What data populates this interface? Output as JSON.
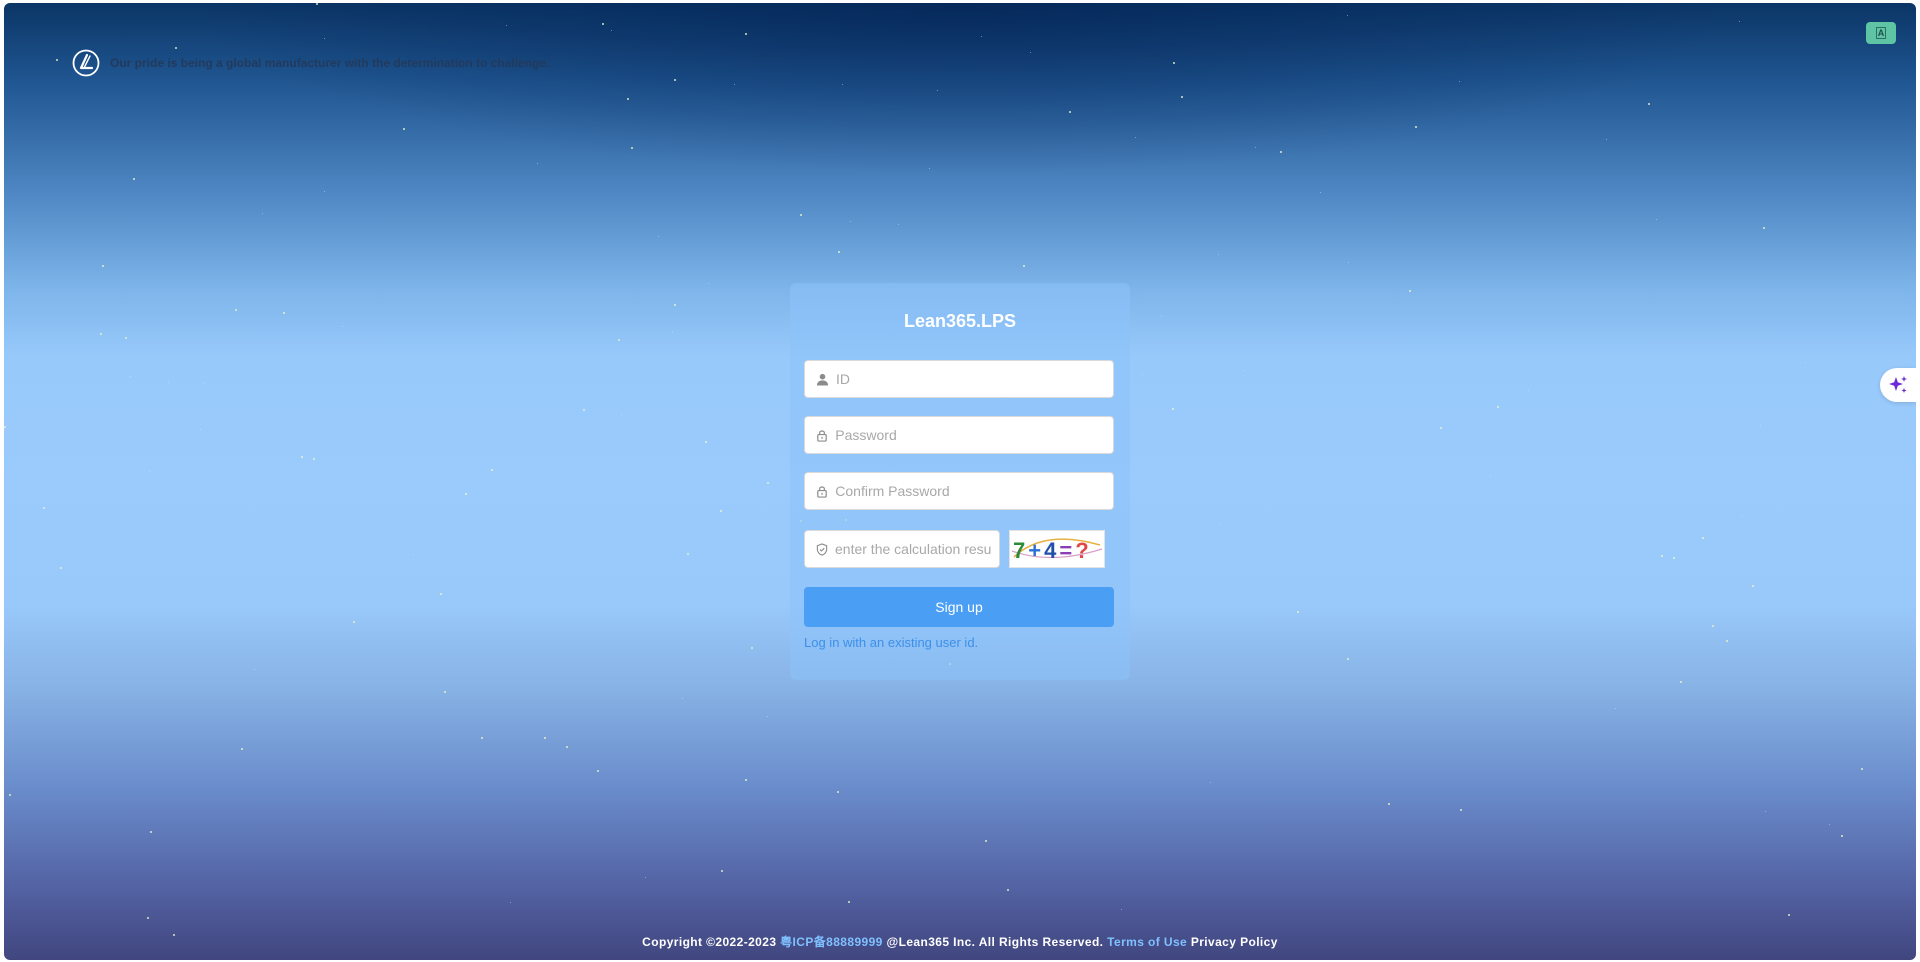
{
  "brand": {
    "logo_icon": "lean-logo-icon",
    "slogan": "Our pride is being a global manufacturer with the determination to challenge."
  },
  "language_switch": {
    "icon": "translate-icon",
    "label": "A"
  },
  "assistant": {
    "icon": "sparkle-icon",
    "color": "#6a2bd6"
  },
  "form": {
    "title": "Lean365.LPS",
    "id_field": {
      "placeholder": "ID",
      "icon": "user-icon"
    },
    "password_field": {
      "placeholder": "Password",
      "icon": "lock-icon"
    },
    "confirm_password_field": {
      "placeholder": "Confirm Password",
      "icon": "lock-icon"
    },
    "captcha_field": {
      "placeholder": "enter the calculation result",
      "icon": "shield-icon"
    },
    "captcha_image": {
      "text": "7+4=?"
    },
    "submit_label": "Sign up",
    "login_link": "Log in with an existing user id."
  },
  "footer": {
    "copyright": "Copyright ©2022-2023",
    "icp": "粤ICP备88889999",
    "company": "@Lean365 Inc. All Rights Reserved.",
    "terms": "Terms of Use",
    "privacy": "Privacy Policy"
  },
  "colors": {
    "primary_button": "#4a9ff5",
    "link": "#3d8fe8",
    "language_button": "#5fc4a4"
  }
}
